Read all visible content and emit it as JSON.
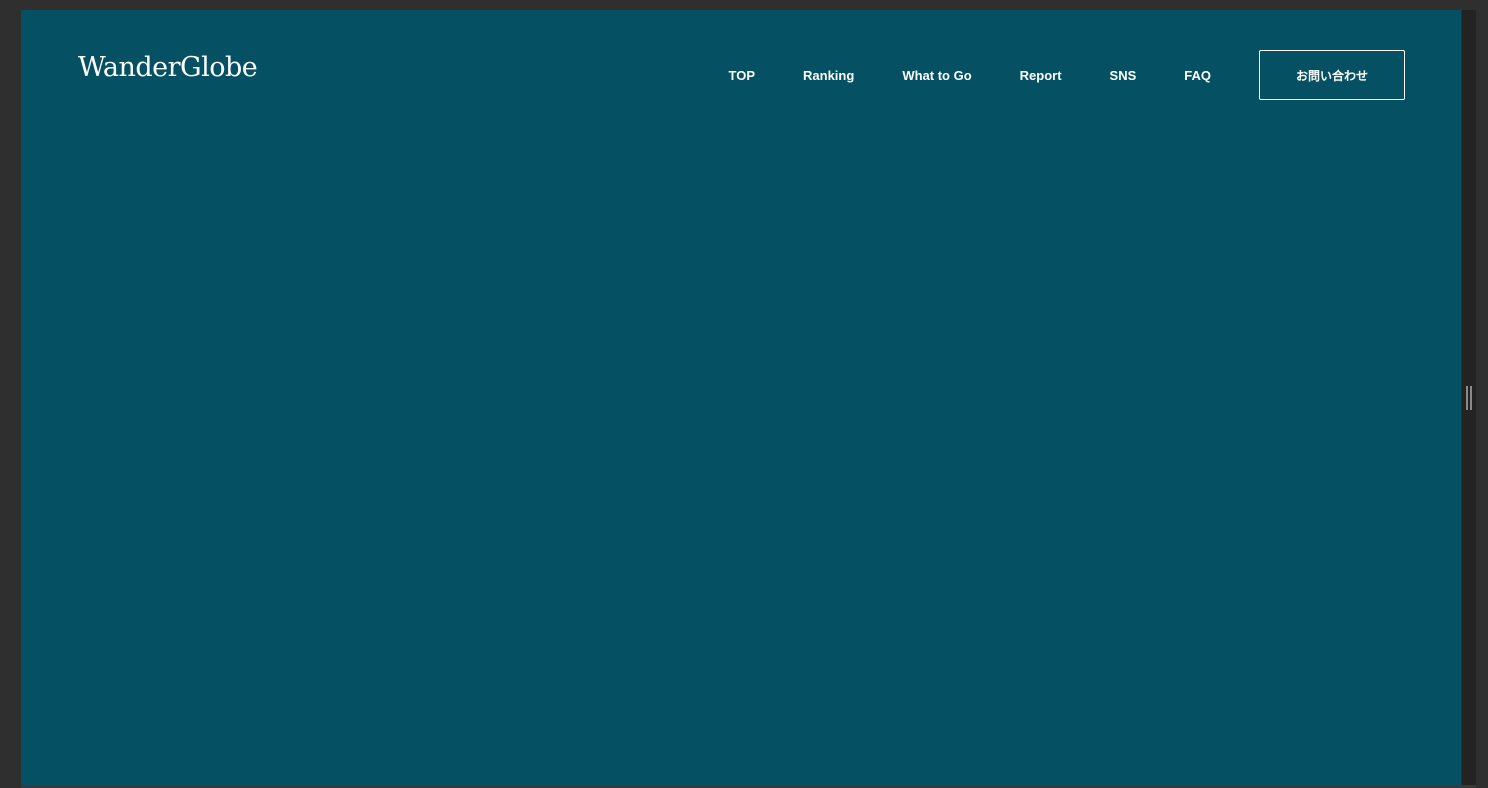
{
  "site": {
    "logo": "WanderGlobe"
  },
  "nav": {
    "items": [
      {
        "label": "TOP"
      },
      {
        "label": "Ranking"
      },
      {
        "label": "What to Go"
      },
      {
        "label": "Report"
      },
      {
        "label": "SNS"
      },
      {
        "label": "FAQ"
      }
    ],
    "contact_label": "お問い合わせ"
  },
  "colors": {
    "background": "#055163",
    "text": "#ffffff",
    "chrome": "#2f2f2f"
  },
  "icons": {
    "resize_handle": "vertical-grip-icon"
  }
}
